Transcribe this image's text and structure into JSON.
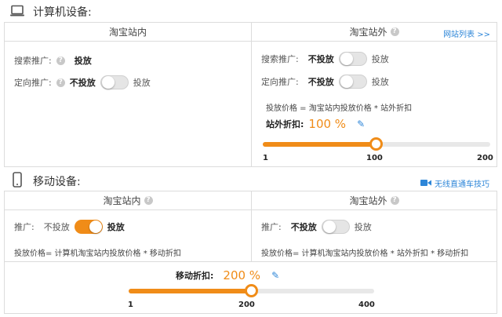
{
  "computer": {
    "title": "计算机设备:",
    "col_in": {
      "header": "淘宝站内",
      "search_label": "搜索推广:",
      "search_value": "投放",
      "target_label": "定向推广:",
      "target_off": "不投放",
      "target_on": "投放"
    },
    "col_out": {
      "header": "淘宝站外",
      "site_list_link": "网站列表 >>",
      "search_label": "搜索推广:",
      "search_off": "不投放",
      "search_on": "投放",
      "target_label": "定向推广:",
      "target_off": "不投放",
      "target_on": "投放",
      "formula": "投放价格 = 淘宝站内投放价格 * 站外折扣",
      "discount_label": "站外折扣:",
      "discount_value": "100 %",
      "slider": {
        "min_label": "1",
        "mid_label": "100",
        "max_label": "200",
        "min": 1,
        "max": 200,
        "value": 100
      }
    }
  },
  "mobile": {
    "title": "移动设备:",
    "tips_link": "无线直通车技巧",
    "col_in": {
      "header": "淘宝站内",
      "promo_label": "推广:",
      "off": "不投放",
      "on": "投放",
      "formula": "投放价格= 计算机淘宝站内投放价格 * 移动折扣"
    },
    "col_out": {
      "header": "淘宝站外",
      "promo_label": "推广:",
      "off": "不投放",
      "on": "投放",
      "formula": "投放价格= 计算机淘宝站内投放价格 * 站外折扣 * 移动折扣"
    },
    "discount_label": "移动折扣:",
    "discount_value": "200 %",
    "slider": {
      "min_label": "1",
      "mid_label": "200",
      "max_label": "400",
      "min": 1,
      "max": 400,
      "value": 200
    }
  },
  "colors": {
    "accent": "#f08c18",
    "link": "#2d86d8",
    "border": "#dcdcdc"
  },
  "icons": {
    "computer": "laptop-icon",
    "mobile": "phone-icon",
    "help": "help-icon",
    "video": "video-camera-icon",
    "edit": "pencil-icon"
  }
}
